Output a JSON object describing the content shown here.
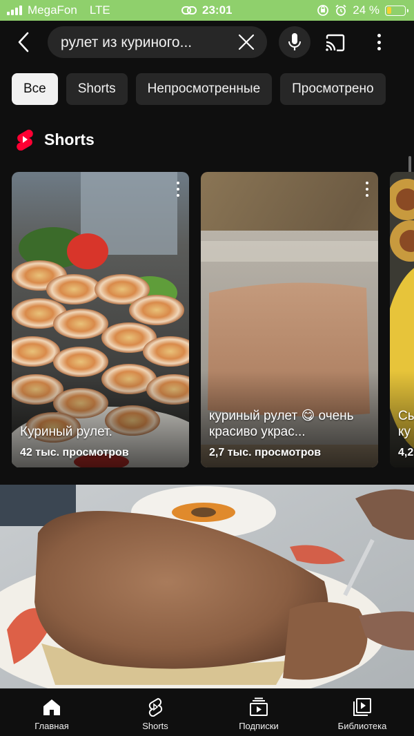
{
  "status_bar": {
    "carrier": "MegaFon",
    "network": "LTE",
    "time": "23:01",
    "battery_percent": "24 %",
    "battery_level": 0.24
  },
  "search": {
    "query": "рулет из куриного..."
  },
  "icons": {
    "back": "back-arrow-icon",
    "clear": "close-icon",
    "mic": "microphone-icon",
    "cast": "cast-icon",
    "more": "more-vertical-icon"
  },
  "chips": [
    {
      "label": "Все",
      "active": true
    },
    {
      "label": "Shorts",
      "active": false
    },
    {
      "label": "Непросмотренные",
      "active": false
    },
    {
      "label": "Просмотрено",
      "active": false
    }
  ],
  "shorts_section": {
    "title": "Shorts",
    "cards": [
      {
        "title": "Куриный рулет.",
        "views": "42 тыс. просмотров"
      },
      {
        "title": "куриный рулет 😋 очень красиво украс...",
        "views": "2,7 тыс. просмотров"
      },
      {
        "title": "Сы ку",
        "views": "4,2"
      }
    ]
  },
  "bottom_nav": [
    {
      "label": "Главная",
      "icon": "home-icon"
    },
    {
      "label": "Shorts",
      "icon": "shorts-icon"
    },
    {
      "label": "Подписки",
      "icon": "subscriptions-icon"
    },
    {
      "label": "Библиотека",
      "icon": "library-icon"
    }
  ],
  "colors": {
    "background": "#0f0f0f",
    "status_bar": "#8fd06c",
    "chip": "#272727",
    "chip_active": "#f1f1f1",
    "shorts_red": "#ff0033"
  }
}
